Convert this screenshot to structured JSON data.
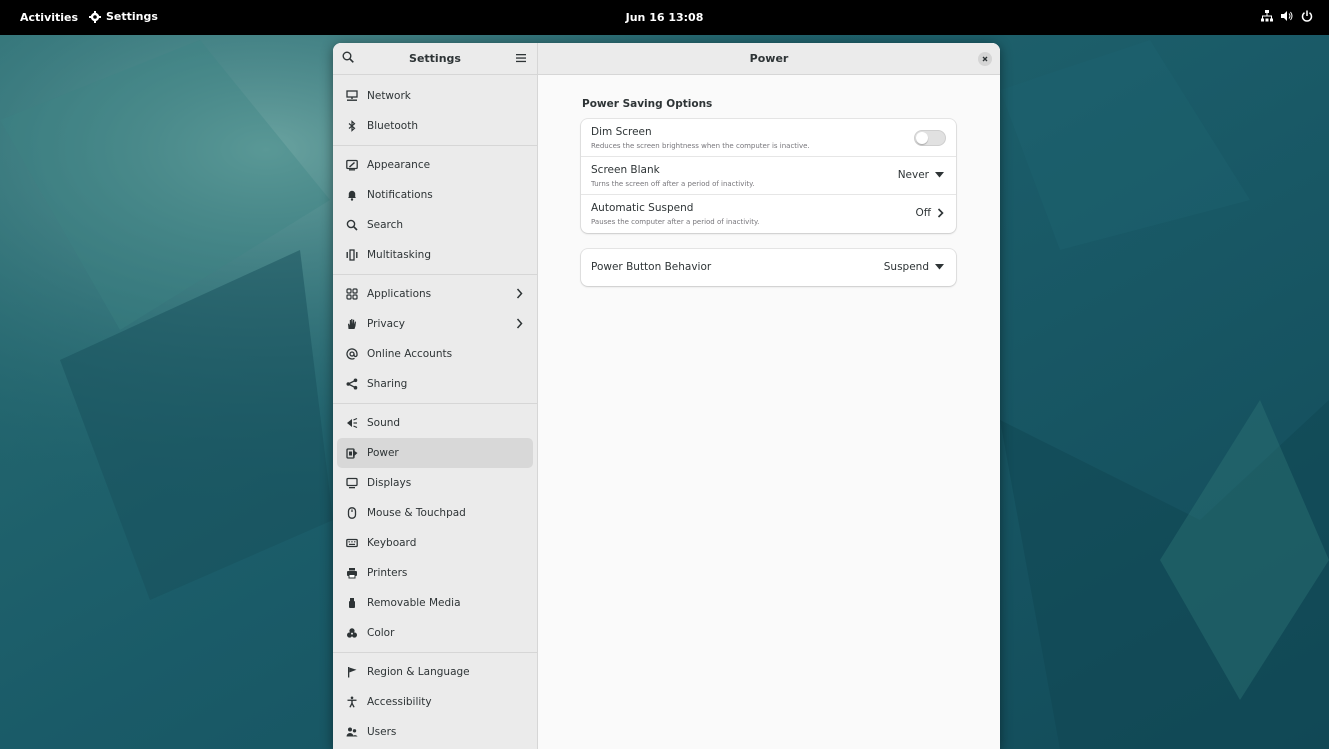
{
  "topbar": {
    "activities": "Activities",
    "app_name": "Settings",
    "clock": "Jun 16  13:08",
    "status_icons": [
      "network-wired-icon",
      "volume-icon",
      "power-icon"
    ]
  },
  "sidebar": {
    "title": "Settings",
    "groups": [
      [
        {
          "label": "Network",
          "icon": "network-icon"
        },
        {
          "label": "Bluetooth",
          "icon": "bluetooth-icon"
        }
      ],
      [
        {
          "label": "Appearance",
          "icon": "appearance-icon"
        },
        {
          "label": "Notifications",
          "icon": "bell-icon"
        },
        {
          "label": "Search",
          "icon": "search-icon"
        },
        {
          "label": "Multitasking",
          "icon": "multitasking-icon"
        }
      ],
      [
        {
          "label": "Applications",
          "icon": "applications-icon",
          "chevron": true
        },
        {
          "label": "Privacy",
          "icon": "hand-icon",
          "chevron": true
        },
        {
          "label": "Online Accounts",
          "icon": "at-icon"
        },
        {
          "label": "Sharing",
          "icon": "share-icon"
        }
      ],
      [
        {
          "label": "Sound",
          "icon": "speaker-icon"
        },
        {
          "label": "Power",
          "icon": "power-battery-icon",
          "selected": true
        },
        {
          "label": "Displays",
          "icon": "display-icon"
        },
        {
          "label": "Mouse & Touchpad",
          "icon": "mouse-icon"
        },
        {
          "label": "Keyboard",
          "icon": "keyboard-icon"
        },
        {
          "label": "Printers",
          "icon": "printer-icon"
        },
        {
          "label": "Removable Media",
          "icon": "usb-icon"
        },
        {
          "label": "Color",
          "icon": "color-icon"
        }
      ],
      [
        {
          "label": "Region & Language",
          "icon": "flag-icon"
        },
        {
          "label": "Accessibility",
          "icon": "accessibility-icon"
        },
        {
          "label": "Users",
          "icon": "users-icon"
        }
      ]
    ]
  },
  "content": {
    "title": "Power",
    "section_title": "Power Saving Options",
    "dim_screen": {
      "title": "Dim Screen",
      "subtitle": "Reduces the screen brightness when the computer is inactive.",
      "enabled": false
    },
    "screen_blank": {
      "title": "Screen Blank",
      "subtitle": "Turns the screen off after a period of inactivity.",
      "value": "Never"
    },
    "automatic_suspend": {
      "title": "Automatic Suspend",
      "subtitle": "Pauses the computer after a period of inactivity.",
      "value": "Off"
    },
    "power_button": {
      "title": "Power Button Behavior",
      "value": "Suspend"
    }
  }
}
